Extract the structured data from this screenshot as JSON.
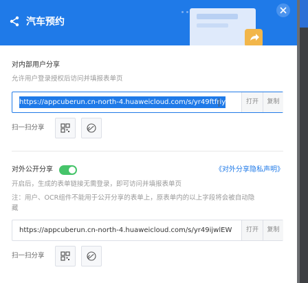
{
  "header": {
    "title": "汽车预约"
  },
  "internal": {
    "title": "对内部用户分享",
    "desc": "允许用户登录授权后访问并填报表单页",
    "url": "https://appcuberun.cn-north-4.huaweicloud.com/s/yr49ftfriy",
    "open_label": "打开",
    "copy_label": "复制",
    "scan_label": "扫一扫分享"
  },
  "external": {
    "title": "对外公开分享",
    "toggle_on": true,
    "privacy_link": "《对外分享隐私声明》",
    "desc": "开启后，生成的表单链接无需登录，即可访问并填报表单页",
    "note_line1": "注：用户、OCR组件不能用于公开分享的表单上，原表单内的以上字段将会被自动隐",
    "note_line2": "藏",
    "url": "https://appcuberun.cn-north-4.huaweicloud.com/s/yr49ijwlEW",
    "open_label": "打开",
    "copy_label": "复制",
    "scan_label": "扫一扫分享"
  },
  "colors": {
    "accent": "#1f7ae8",
    "toggle_on": "#46c46a"
  },
  "icons": [
    "share-icon",
    "close-icon",
    "qrcode-icon",
    "link-icon"
  ]
}
